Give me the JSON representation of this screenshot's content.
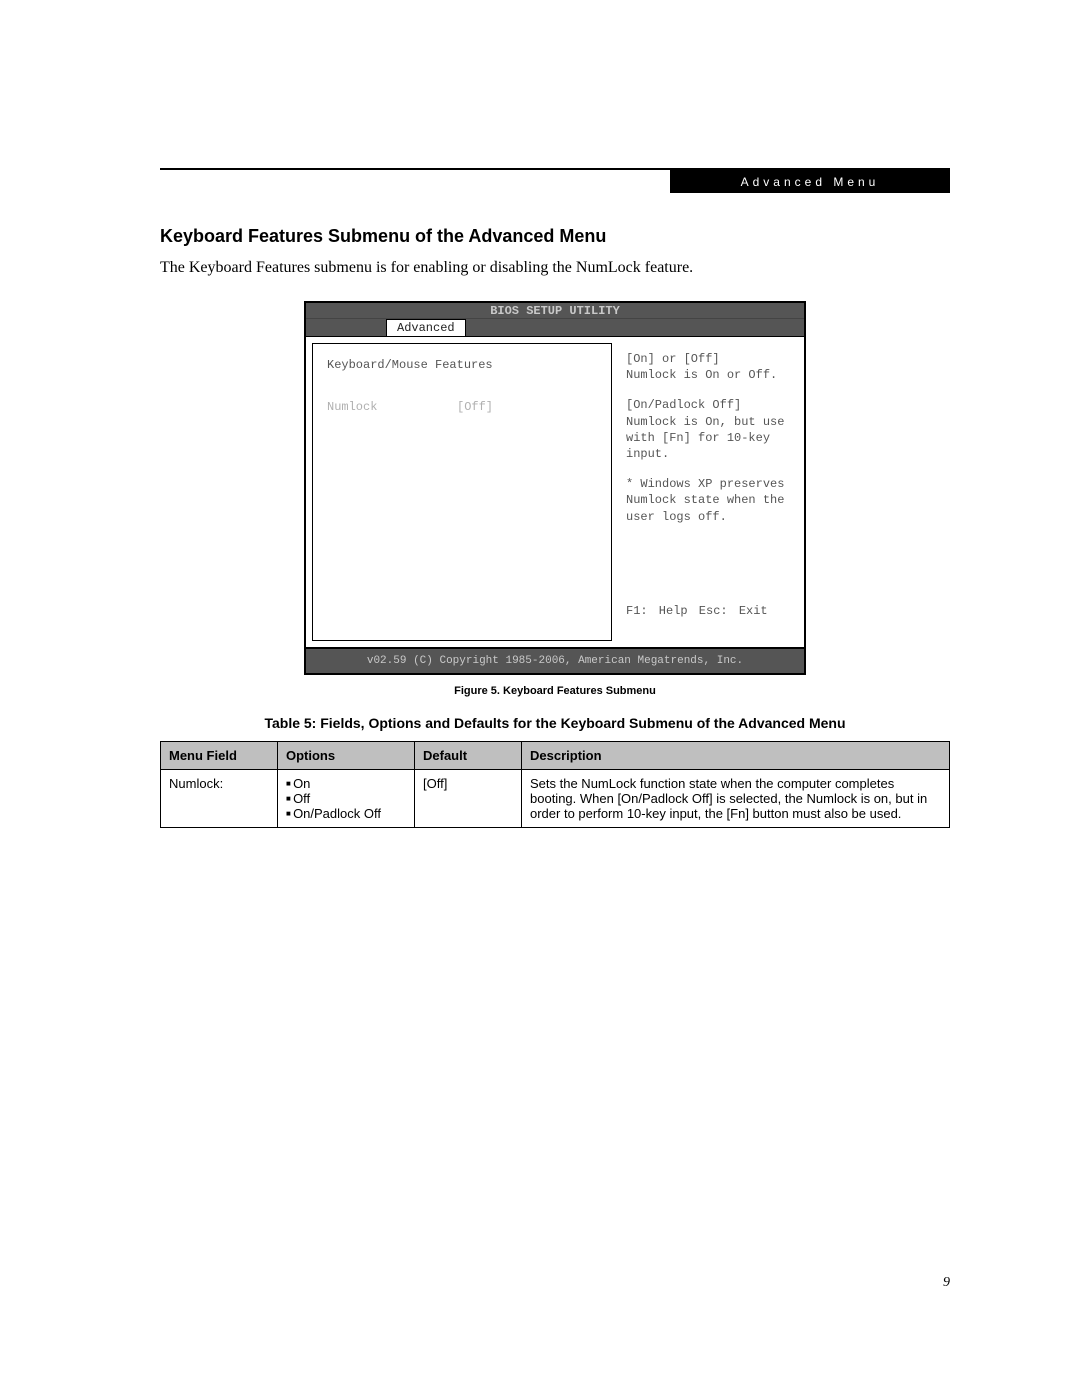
{
  "header_badge": "Advanced Menu",
  "section_heading": "Keyboard Features Submenu of the Advanced Menu",
  "intro_text": "The Keyboard Features submenu is for enabling or disabling the NumLock feature.",
  "bios": {
    "title": "BIOS SETUP UTILITY",
    "tab": "Advanced",
    "left_heading": "Keyboard/Mouse Features",
    "setting_name": "Numlock",
    "setting_value": "[Off]",
    "help1": "[On] or [Off]\nNumlock is On or Off.",
    "help2": "[On/Padlock Off]\nNumlock is On, but use with [Fn] for 10-key input.",
    "help3": "* Windows XP preserves Numlock state when the user logs off.",
    "footer_keys": "F1: Help   Esc: Exit",
    "copyright": "v02.59 (C) Copyright 1985-2006, American Megatrends, Inc."
  },
  "figure_caption": "Figure 5.  Keyboard Features Submenu",
  "table_caption": "Table 5: Fields, Options and Defaults for the Keyboard Submenu of the Advanced Menu",
  "table": {
    "headers": {
      "menu": "Menu Field",
      "options": "Options",
      "default": "Default",
      "desc": "Description"
    },
    "row": {
      "menu": "Numlock:",
      "options": [
        "On",
        "Off",
        "On/Padlock Off"
      ],
      "default": "[Off]",
      "desc": "Sets the NumLock function state when the computer completes booting. When [On/Padlock Off] is selected, the Numlock is on, but in order to perform 10-key input, the [Fn] button must also be used."
    }
  },
  "page_number": "9"
}
